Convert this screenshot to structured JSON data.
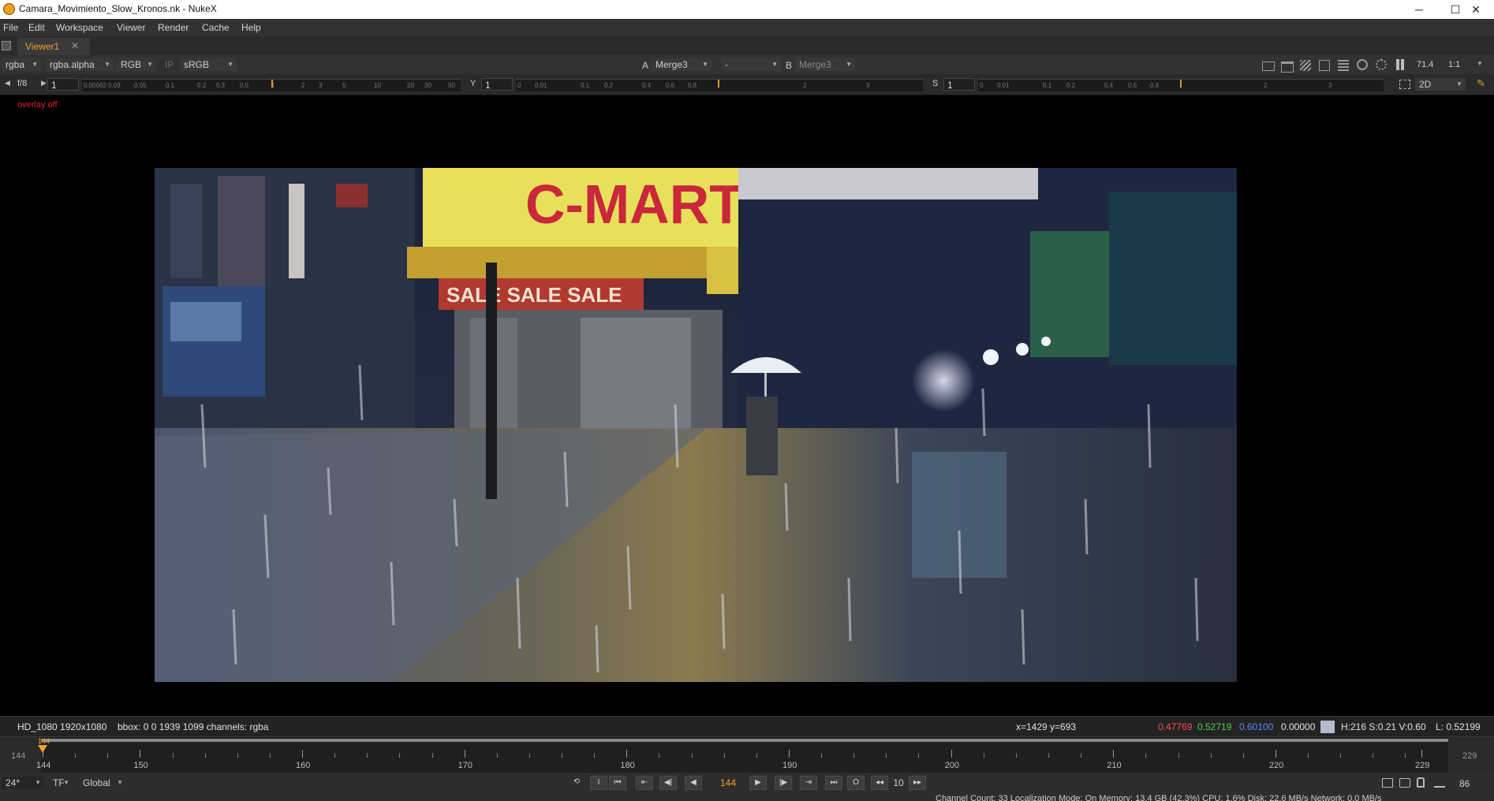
{
  "window": {
    "title": "Camara_Movimiento_Slow_Kronos.nk - NukeX",
    "minimize_glyph": "─",
    "maximize_glyph": "☐",
    "close_glyph": "✕"
  },
  "menu": {
    "items": [
      "File",
      "Edit",
      "Workspace",
      "Viewer",
      "Render",
      "Cache",
      "Help"
    ]
  },
  "tabs": [
    {
      "label": "Viewer1",
      "close_glyph": "✕"
    }
  ],
  "toolbar": {
    "channels": "rgba",
    "layer": "rgba.alpha",
    "display": "RGB",
    "ip": "IP",
    "lut": "sRGB",
    "a_label": "A",
    "a_input": "Merge3",
    "composite": "-",
    "b_label": "B",
    "b_input": "Merge3",
    "zoom": "71.4",
    "ratio": "1:1"
  },
  "toolbar2": {
    "fstop": "f/8",
    "gain": "1",
    "y_label": "Y",
    "gamma": "1",
    "s_label": "S",
    "saturation": "1",
    "mode": "2D"
  },
  "viewer": {
    "overlay_text": "overlay off"
  },
  "info": {
    "format": "HD_1080 1920x1080",
    "bbox": "bbox: 0 0 1939 1099 channels: rgba",
    "coords": "x=1429 y=693",
    "r": "0.47769",
    "g": "0.52719",
    "b": "0.60100",
    "a": "0.00000",
    "hsv": "H:216 S:0.21 V:0.60",
    "lum": "L: 0.52199",
    "swatch_color": "#b4bccb",
    "colors": {
      "r": "#ff4d4d",
      "g": "#4cd24c",
      "b": "#5a8cff",
      "a": "#e8e8e8"
    }
  },
  "timeline": {
    "in_frame": "144",
    "out_frame": "229",
    "current_frame": "144",
    "first": 144,
    "last": 229,
    "labels": [
      "144",
      "150",
      "160",
      "170",
      "180",
      "190",
      "200",
      "210",
      "220",
      "229"
    ]
  },
  "playback": {
    "fps": "24*",
    "tf": "TF",
    "scope": "Global",
    "frame": "144",
    "increment": "10",
    "end_value": "86"
  },
  "status": {
    "text": "Channel Count: 33  Localization Mode: On  Memory: 13.4 GB (42.3%)  CPU: 1.6%  Disk: 22.6 MB/s  Network: 0.0 MB/s"
  },
  "accent": "#f0a030"
}
